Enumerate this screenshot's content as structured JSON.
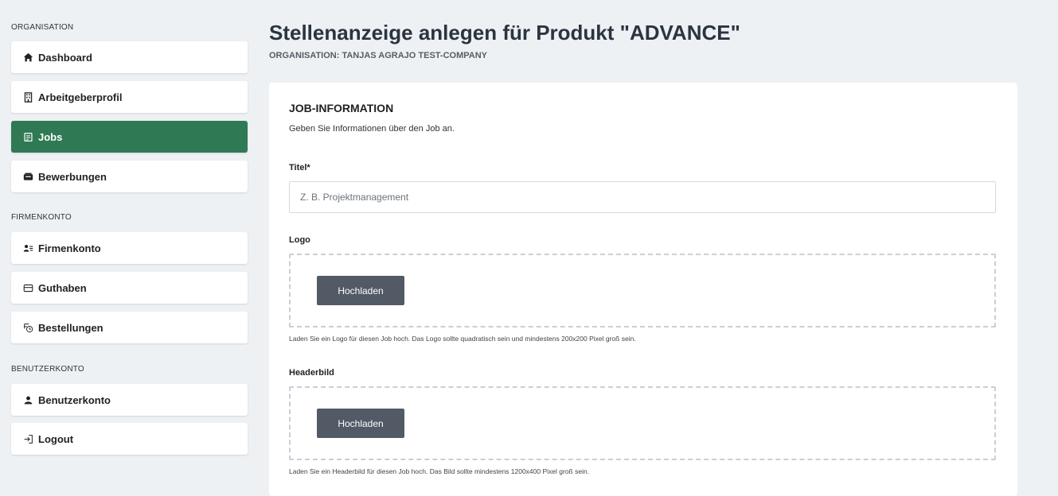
{
  "sidebar": {
    "sections": [
      {
        "label": "ORGANISATION"
      },
      {
        "label": "FIRMENKONTO"
      },
      {
        "label": "BENUTZERKONTO"
      }
    ],
    "items": [
      {
        "label": "Dashboard",
        "icon": "home-icon"
      },
      {
        "label": "Arbeitgeberprofil",
        "icon": "building-icon"
      },
      {
        "label": "Jobs",
        "icon": "document-icon",
        "active": true
      },
      {
        "label": "Bewerbungen",
        "icon": "inbox-icon"
      },
      {
        "label": "Firmenkonto",
        "icon": "users-list-icon"
      },
      {
        "label": "Guthaben",
        "icon": "wallet-icon"
      },
      {
        "label": "Bestellungen",
        "icon": "receipt-icon"
      },
      {
        "label": "Benutzerkonto",
        "icon": "user-icon"
      },
      {
        "label": "Logout",
        "icon": "logout-icon"
      }
    ]
  },
  "header": {
    "title": "Stellenanzeige anlegen für Produkt \"ADVANCE\"",
    "subtitle": "ORGANISATION: TANJAS AGRAJO TEST-COMPANY"
  },
  "card": {
    "heading": "JOB-INFORMATION",
    "description": "Geben Sie Informationen über den Job an.",
    "title_field": {
      "label": "Titel*",
      "placeholder": "Z. B. Projektmanagement",
      "value": ""
    },
    "logo": {
      "label": "Logo",
      "button": "Hochladen",
      "hint": "Laden Sie ein Logo für diesen Job hoch. Das Logo sollte quadratisch sein und mindestens 200x200 Pixel groß sein."
    },
    "header_image": {
      "label": "Headerbild",
      "button": "Hochladen",
      "hint": "Laden Sie ein Headerbild für diesen Job hoch. Das Bild sollte mindestens 1200x400 Pixel groß sein."
    }
  },
  "colors": {
    "background": "#eef1f4",
    "active_nav": "#2f7a55",
    "upload_button": "#525a66"
  }
}
